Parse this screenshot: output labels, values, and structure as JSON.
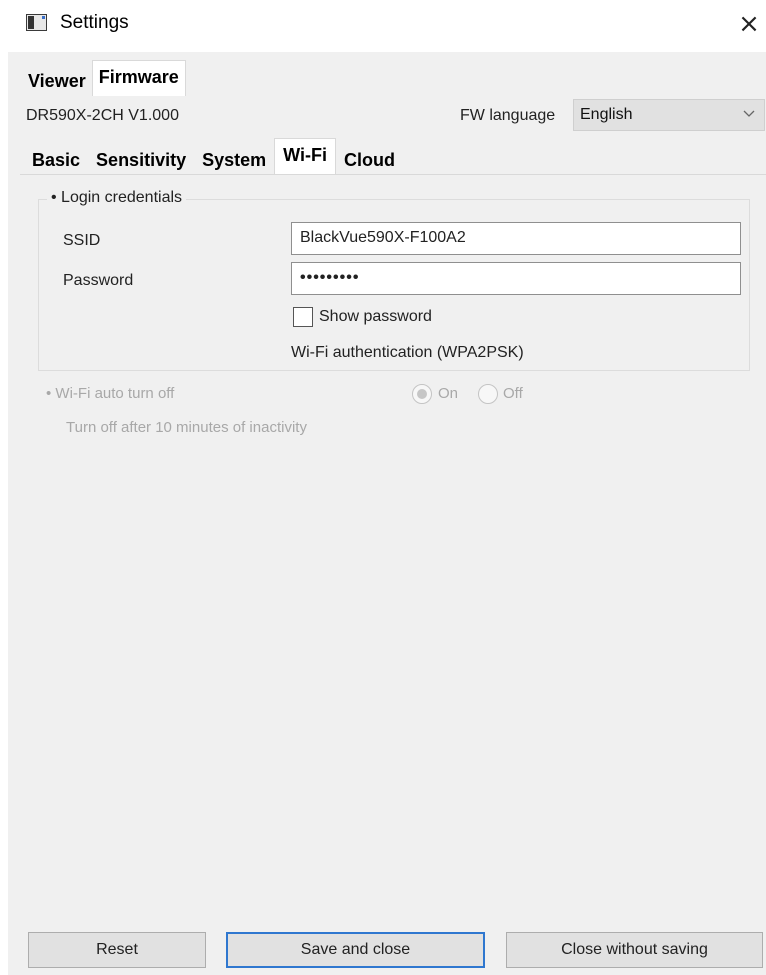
{
  "window": {
    "title": "Settings",
    "close_glyph": "×",
    "app_icon": "settings-window-icon"
  },
  "top_tabs": [
    {
      "label": "Viewer",
      "active": false
    },
    {
      "label": "Firmware",
      "active": true
    }
  ],
  "firmware": {
    "model_version": "DR590X-2CH  V1.000",
    "fw_language_label": "FW language",
    "fw_language_value": "English"
  },
  "sub_tabs": [
    {
      "label": "Basic",
      "active": false
    },
    {
      "label": "Sensitivity",
      "active": false
    },
    {
      "label": "System",
      "active": false
    },
    {
      "label": "Wi-Fi",
      "active": true
    },
    {
      "label": "Cloud",
      "active": false
    }
  ],
  "login": {
    "group_title": "• Login credentials",
    "ssid_label": "SSID",
    "ssid_value": "BlackVue590X-F100A2",
    "password_label": "Password",
    "password_value": "•••••••••",
    "show_password_label": "Show password",
    "show_password_checked": false,
    "auth_text": "Wi-Fi authentication (WPA2PSK)"
  },
  "auto_off": {
    "title": "• Wi-Fi auto turn off",
    "on_label": "On",
    "off_label": "Off",
    "selected": "On",
    "description": "Turn off after 10 minutes of inactivity"
  },
  "buttons": {
    "reset": "Reset",
    "save_close": "Save and close",
    "close_without_saving": "Close without saving"
  },
  "colors": {
    "default_button_border": "#2f77cf",
    "dialog_background": "#f0f0f0",
    "disabled_text": "#a8a8a8"
  }
}
